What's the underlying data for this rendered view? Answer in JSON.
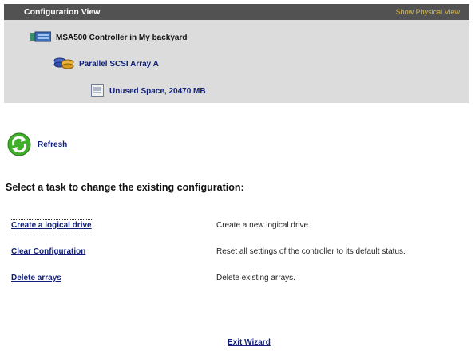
{
  "config_view": {
    "title": "Configuration View",
    "physical_view_link": "Show Physical View",
    "tree": {
      "controller": {
        "label": "MSA500 Controller in My backyard",
        "icon": "controller-icon"
      },
      "array": {
        "label": "Parallel SCSI Array A",
        "icon": "array-icon"
      },
      "unused_space": {
        "label": "Unused Space, 20470 MB",
        "icon": "unused-space-icon"
      }
    }
  },
  "refresh": {
    "label": "Refresh",
    "icon": "refresh-icon"
  },
  "task_section": {
    "heading": "Select a task to change the existing configuration:",
    "tasks": [
      {
        "link": "Create a logical drive",
        "description": "Create a new logical drive."
      },
      {
        "link": "Clear Configuration",
        "description": "Reset all settings of the controller to its default status."
      },
      {
        "link": "Delete arrays",
        "description": "Delete existing arrays."
      }
    ]
  },
  "exit_wizard": "Exit Wizard",
  "colors": {
    "header_bg": "#525252",
    "panel_bg": "#dcdcdc",
    "link": "#0f1f7a",
    "physical_link": "#d8b94a",
    "refresh_green": "#3fae2a"
  }
}
